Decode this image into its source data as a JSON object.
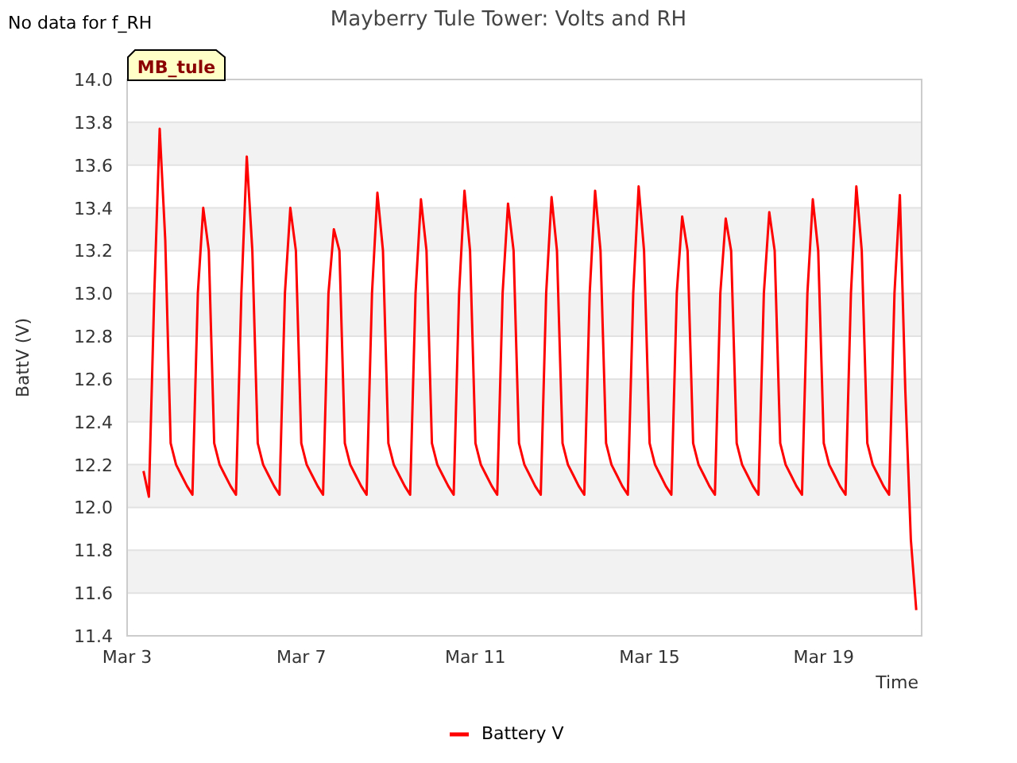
{
  "note": "No data for f_RH",
  "chart_data": {
    "type": "line",
    "title": "Mayberry Tule Tower: Volts and RH",
    "xlabel": "Time",
    "ylabel": "BattV (V)",
    "grid": true,
    "ylim": [
      11.4,
      14.0
    ],
    "yticks": [
      {
        "value": 11.4,
        "label": "11.4"
      },
      {
        "value": 11.6,
        "label": "11.6"
      },
      {
        "value": 11.8,
        "label": "11.8"
      },
      {
        "value": 12.0,
        "label": "12.0"
      },
      {
        "value": 12.2,
        "label": "12.2"
      },
      {
        "value": 12.4,
        "label": "12.4"
      },
      {
        "value": 12.6,
        "label": "12.6"
      },
      {
        "value": 12.8,
        "label": "12.8"
      },
      {
        "value": 13.0,
        "label": "13.0"
      },
      {
        "value": 13.2,
        "label": "13.2"
      },
      {
        "value": 13.4,
        "label": "13.4"
      },
      {
        "value": 13.6,
        "label": "13.6"
      },
      {
        "value": 13.8,
        "label": "13.8"
      },
      {
        "value": 14.0,
        "label": "14.0"
      }
    ],
    "categories": [
      "Mar 3",
      null,
      null,
      null,
      null,
      null,
      null,
      null,
      null,
      null,
      null,
      null,
      null,
      null,
      null,
      null,
      null,
      null,
      null,
      null,
      null,
      null,
      null,
      null,
      null,
      null,
      null,
      null,
      null,
      null,
      null,
      null,
      "Mar 7",
      null,
      null,
      null,
      null,
      null,
      null,
      null,
      null,
      null,
      null,
      null,
      null,
      null,
      null,
      null,
      null,
      null,
      null,
      null,
      null,
      null,
      null,
      null,
      null,
      null,
      null,
      null,
      null,
      null,
      null,
      null,
      "Mar 11",
      null,
      null,
      null,
      null,
      null,
      null,
      null,
      null,
      null,
      null,
      null,
      null,
      null,
      null,
      null,
      null,
      null,
      null,
      null,
      null,
      null,
      null,
      null,
      null,
      null,
      null,
      null,
      null,
      null,
      null,
      null,
      "Mar 15",
      null,
      null,
      null,
      null,
      null,
      null,
      null,
      null,
      null,
      null,
      null,
      null,
      null,
      null,
      null,
      null,
      null,
      null,
      null,
      null,
      null,
      null,
      null,
      null,
      null,
      null,
      null,
      null,
      null,
      null,
      null,
      "Mar 19",
      null,
      null,
      null,
      null,
      null,
      null,
      null,
      null,
      null,
      null,
      null,
      null,
      null,
      null,
      null,
      null,
      null
    ],
    "series": [
      {
        "name": "Battery V",
        "color": "#ff0000",
        "values": [
          null,
          null,
          null,
          12.17,
          12.05,
          13.0,
          13.77,
          13.25,
          12.3,
          12.2,
          12.15,
          12.1,
          12.06,
          13.0,
          13.4,
          13.2,
          12.3,
          12.2,
          12.15,
          12.1,
          12.06,
          13.0,
          13.64,
          13.2,
          12.3,
          12.2,
          12.15,
          12.1,
          12.06,
          13.0,
          13.4,
          13.2,
          12.3,
          12.2,
          12.15,
          12.1,
          12.06,
          13.0,
          13.3,
          13.2,
          12.3,
          12.2,
          12.15,
          12.1,
          12.06,
          13.0,
          13.47,
          13.2,
          12.3,
          12.2,
          12.15,
          12.1,
          12.06,
          13.0,
          13.44,
          13.2,
          12.3,
          12.2,
          12.15,
          12.1,
          12.06,
          13.0,
          13.48,
          13.2,
          12.3,
          12.2,
          12.15,
          12.1,
          12.06,
          13.0,
          13.42,
          13.2,
          12.3,
          12.2,
          12.15,
          12.1,
          12.06,
          13.0,
          13.45,
          13.2,
          12.3,
          12.2,
          12.15,
          12.1,
          12.06,
          13.0,
          13.48,
          13.2,
          12.3,
          12.2,
          12.15,
          12.1,
          12.06,
          13.0,
          13.5,
          13.2,
          12.3,
          12.2,
          12.15,
          12.1,
          12.06,
          13.0,
          13.36,
          13.2,
          12.3,
          12.2,
          12.15,
          12.1,
          12.06,
          13.0,
          13.35,
          13.2,
          12.3,
          12.2,
          12.15,
          12.1,
          12.06,
          13.0,
          13.38,
          13.2,
          12.3,
          12.2,
          12.15,
          12.1,
          12.06,
          13.0,
          13.44,
          13.2,
          12.3,
          12.2,
          12.15,
          12.1,
          12.06,
          13.0,
          13.5,
          13.2,
          12.3,
          12.2,
          12.15,
          12.1,
          12.06,
          13.0,
          13.46,
          12.55,
          11.85,
          11.52
        ]
      }
    ],
    "annotations": [
      "MB_tule"
    ]
  }
}
